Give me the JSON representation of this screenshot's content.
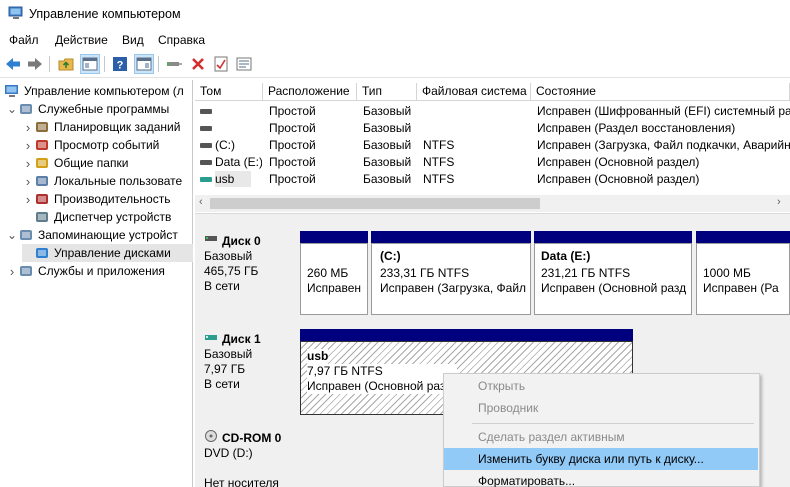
{
  "window": {
    "title": "Управление компьютером"
  },
  "menu": [
    "Файл",
    "Действие",
    "Вид",
    "Справка"
  ],
  "toolbar_icons": [
    "back-arrow-icon",
    "forward-arrow-icon",
    "up-folder-icon",
    "show-hide-tree-icon",
    "help-icon",
    "console-view-icon",
    "connect-icon",
    "delete-icon",
    "properties-icon",
    "list-icon"
  ],
  "tree": {
    "root": "Управление компьютером (л",
    "items": [
      {
        "label": "Служебные программы",
        "level": 1,
        "expander": "open"
      },
      {
        "label": "Планировщик заданий",
        "level": 2,
        "expander": "closed"
      },
      {
        "label": "Просмотр событий",
        "level": 2,
        "expander": "closed"
      },
      {
        "label": "Общие папки",
        "level": 2,
        "expander": "closed"
      },
      {
        "label": "Локальные пользовате",
        "level": 2,
        "expander": "closed"
      },
      {
        "label": "Производительность",
        "level": 2,
        "expander": "closed"
      },
      {
        "label": "Диспетчер устройств",
        "level": 2,
        "expander": ""
      },
      {
        "label": "Запоминающие устройст",
        "level": 1,
        "expander": "open"
      },
      {
        "label": "Управление дисками",
        "level": 2,
        "expander": "",
        "selected": true
      },
      {
        "label": "Службы и приложения",
        "level": 1,
        "expander": "closed"
      }
    ]
  },
  "volumes": {
    "columns": [
      "Том",
      "Расположение",
      "Тип",
      "Файловая система",
      "Состояние"
    ],
    "rows": [
      [
        "",
        "Простой",
        "Базовый",
        "",
        "Исправен (Шифрованный (EFI) системный раз"
      ],
      [
        "",
        "Простой",
        "Базовый",
        "",
        "Исправен (Раздел восстановления)"
      ],
      [
        "(C:)",
        "Простой",
        "Базовый",
        "NTFS",
        "Исправен (Загрузка, Файл подкачки, Аварийн"
      ],
      [
        "Data (E:)",
        "Простой",
        "Базовый",
        "NTFS",
        "Исправен (Основной раздел)"
      ],
      [
        "usb",
        "Простой",
        "Базовый",
        "NTFS",
        "Исправен (Основной раздел)"
      ]
    ]
  },
  "disks": [
    {
      "name": "Диск 0",
      "type": "Базовый",
      "size": "465,75 ГБ",
      "status": "В сети",
      "partitions": [
        {
          "title": "",
          "size": "260 МБ",
          "status": "Исправен"
        },
        {
          "title": "(C:)",
          "size": "233,31 ГБ NTFS",
          "status": "Исправен (Загрузка, Файл"
        },
        {
          "title": "Data  (E:)",
          "size": "231,21 ГБ NTFS",
          "status": "Исправен (Основной разд"
        },
        {
          "title": "",
          "size": "1000 МБ",
          "status": "Исправен (Ра"
        }
      ]
    },
    {
      "name": "Диск 1",
      "type": "Базовый",
      "size": "7,97 ГБ",
      "status": "В сети",
      "partitions": [
        {
          "title": "usb",
          "size": "7,97 ГБ NTFS",
          "status": "Исправен (Основной раз"
        }
      ]
    },
    {
      "name": "CD-ROM 0",
      "type": "DVD (D:)",
      "size": "",
      "status": "Нет носителя"
    }
  ],
  "context_menu": {
    "items": [
      {
        "label": "Открыть",
        "disabled": true
      },
      {
        "label": "Проводник",
        "disabled": true
      },
      {
        "label": "Сделать раздел активным",
        "disabled": true
      },
      {
        "label": "Изменить букву диска или путь к диску...",
        "disabled": false,
        "highlighted": true
      },
      {
        "label": "Форматировать...",
        "disabled": false
      }
    ]
  },
  "colors": {
    "partition_bar": "#00007f",
    "selection": "#91c9f7",
    "usb_icon": "#2a9d8f"
  }
}
